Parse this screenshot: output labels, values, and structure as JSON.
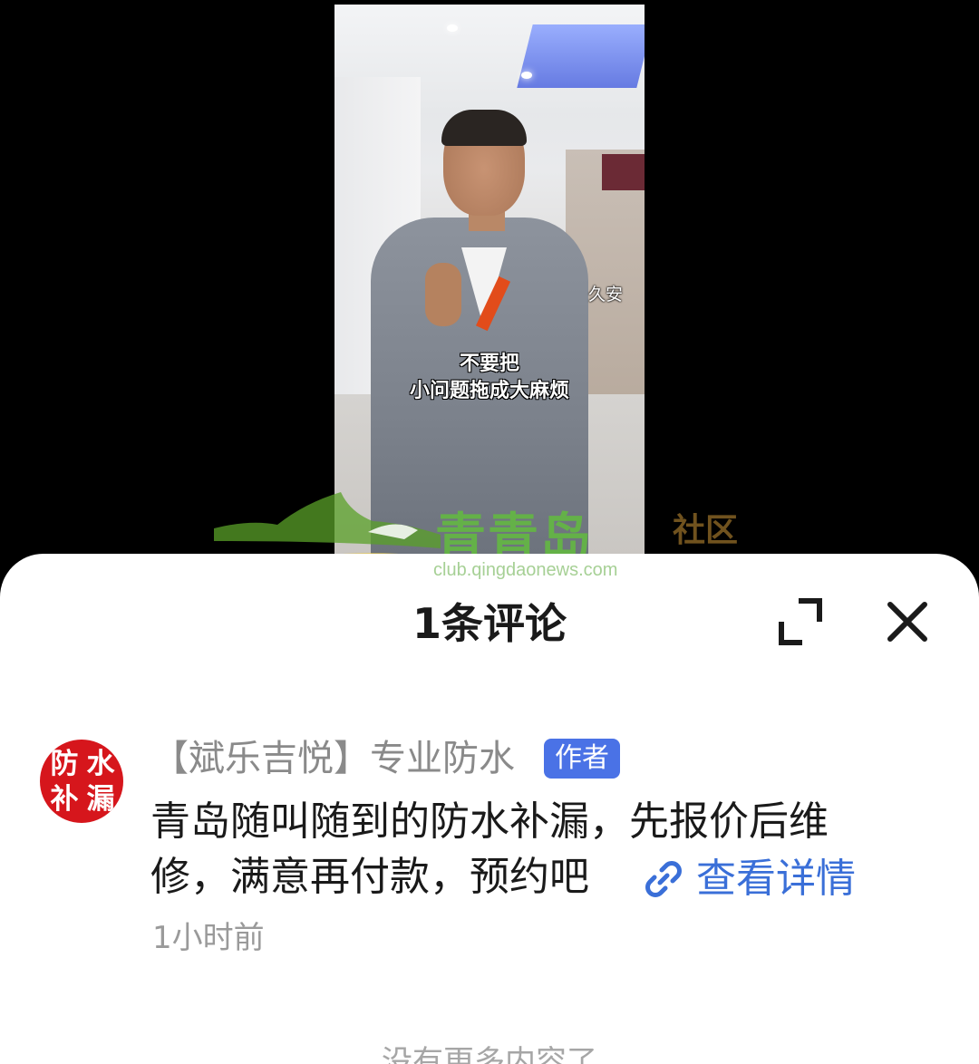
{
  "video": {
    "author_watermark": "久安",
    "subtitle_line1": "不要把",
    "subtitle_line2": "小问题拖成大麻烦"
  },
  "site_watermark": {
    "name": "青青岛",
    "section": "社区",
    "url": "club.qingdaonews.com"
  },
  "comments_panel": {
    "title": "1条评论",
    "expand_icon": "expand-icon",
    "close_icon": "close-icon"
  },
  "comment": {
    "avatar_text": [
      "防",
      "水",
      "补",
      "漏"
    ],
    "author": "【斌乐吉悦】专业防水",
    "badge": "作者",
    "text_line1": "青岛随叫随到的防水补漏，先报价后维",
    "text_line2": "修，满意再付款，预约吧",
    "link_label": "查看详情",
    "link_icon": "link-icon",
    "time": "1小时前"
  },
  "footer": {
    "no_more": "没有更多内容了"
  },
  "colors": {
    "badge": "#4a72e6",
    "link": "#3a6fd8",
    "avatar_bg": "#d6161c"
  }
}
